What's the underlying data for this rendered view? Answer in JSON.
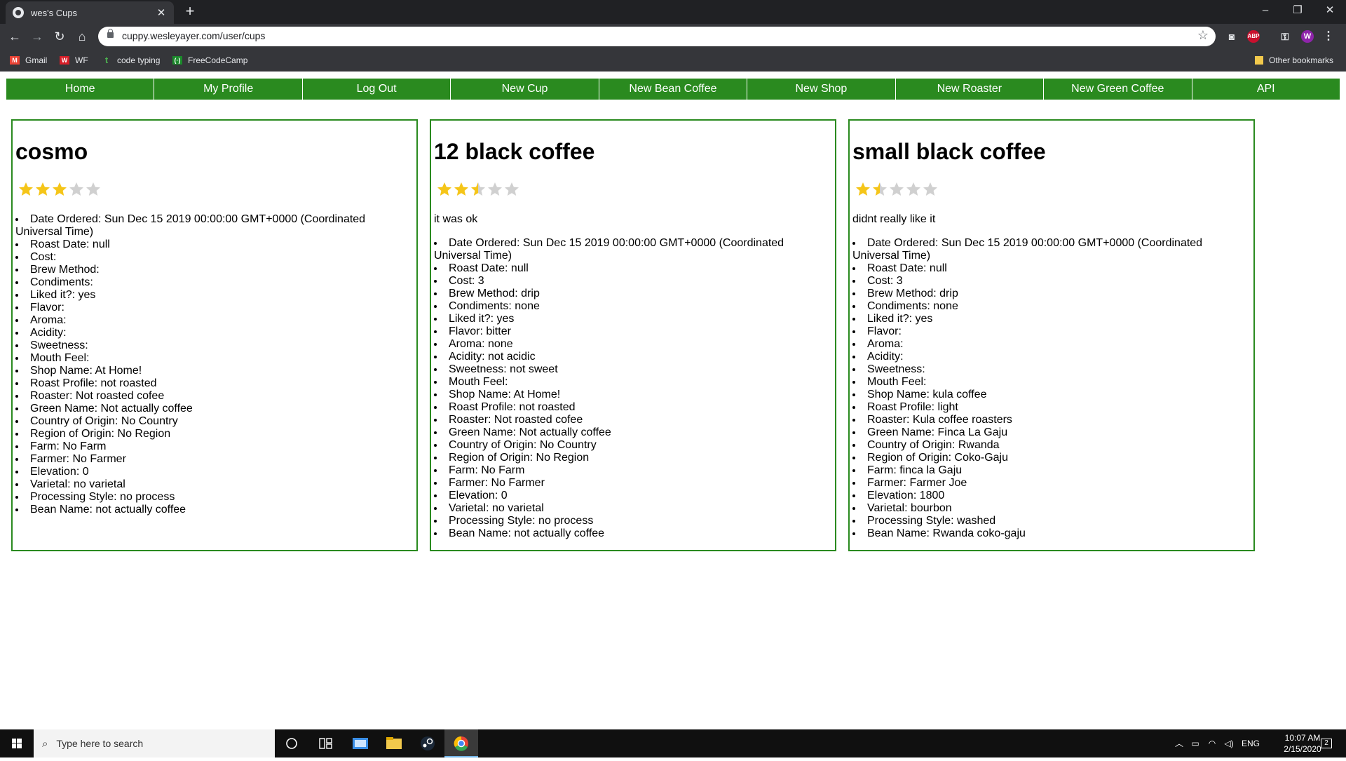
{
  "browser": {
    "tab_title": "wes's Cups",
    "url": "cuppy.wesleyayer.com/user/cups",
    "profile_initial": "W",
    "abp_label": "ABP",
    "bookmarks": [
      {
        "label": "Gmail",
        "icon": "gmail-icon",
        "color": "#ea4335"
      },
      {
        "label": "WF",
        "icon": "wf-icon",
        "color": "#d71e28"
      },
      {
        "label": "code typing",
        "icon": "t-icon",
        "color": "#4caf50"
      },
      {
        "label": "FreeCodeCamp",
        "icon": "freecodecamp-icon",
        "color": "#1b8a2b"
      }
    ],
    "other_bookmarks": "Other bookmarks"
  },
  "nav": {
    "items": [
      "Home",
      "My Profile",
      "Log Out",
      "New Cup",
      "New Bean Coffee",
      "New Shop",
      "New Roaster",
      "New Green Coffee",
      "API"
    ]
  },
  "colors": {
    "accent": "#2a8a1f",
    "star_filled": "#f5c518",
    "star_empty": "#d0d0d0"
  },
  "cups": [
    {
      "name": "cosmo",
      "rating": 3,
      "comment": "",
      "details": [
        "Date Ordered: Sun Dec 15 2019 00:00:00 GMT+0000 (Coordinated Universal Time)",
        "Roast Date: null",
        "Cost:",
        "Brew Method:",
        "Condiments:",
        "Liked it?: yes",
        "Flavor:",
        "Aroma:",
        "Acidity:",
        "Sweetness:",
        "Mouth Feel:",
        "Shop Name: At Home!",
        "Roast Profile: not roasted",
        "Roaster: Not roasted cofee",
        "Green Name: Not actually coffee",
        "Country of Origin: No Country",
        "Region of Origin: No Region",
        "Farm: No Farm",
        "Farmer: No Farmer",
        "Elevation: 0",
        "Varietal: no varietal",
        "Processing Style: no process",
        "Bean Name: not actually coffee"
      ]
    },
    {
      "name": "12 black coffee",
      "rating": 2.5,
      "comment": "it was ok",
      "details": [
        "Date Ordered: Sun Dec 15 2019 00:00:00 GMT+0000 (Coordinated Universal Time)",
        "Roast Date: null",
        "Cost: 3",
        "Brew Method: drip",
        "Condiments: none",
        "Liked it?: yes",
        "Flavor: bitter",
        "Aroma: none",
        "Acidity: not acidic",
        "Sweetness: not sweet",
        "Mouth Feel:",
        "Shop Name: At Home!",
        "Roast Profile: not roasted",
        "Roaster: Not roasted cofee",
        "Green Name: Not actually coffee",
        "Country of Origin: No Country",
        "Region of Origin: No Region",
        "Farm: No Farm",
        "Farmer: No Farmer",
        "Elevation: 0",
        "Varietal: no varietal",
        "Processing Style: no process",
        "Bean Name: not actually coffee"
      ]
    },
    {
      "name": "small black coffee",
      "rating": 1.5,
      "comment": "didnt really like it",
      "details": [
        "Date Ordered: Sun Dec 15 2019 00:00:00 GMT+0000 (Coordinated Universal Time)",
        "Roast Date: null",
        "Cost: 3",
        "Brew Method: drip",
        "Condiments: none",
        "Liked it?: yes",
        "Flavor:",
        "Aroma:",
        "Acidity:",
        "Sweetness:",
        "Mouth Feel:",
        "Shop Name: kula coffee",
        "Roast Profile: light",
        "Roaster: Kula coffee roasters",
        "Green Name: Finca La Gaju",
        "Country of Origin: Rwanda",
        "Region of Origin: Coko-Gaju",
        "Farm: finca la Gaju",
        "Farmer: Farmer Joe",
        "Elevation: 1800",
        "Varietal: bourbon",
        "Processing Style: washed",
        "Bean Name: Rwanda coko-gaju"
      ]
    }
  ],
  "taskbar": {
    "search_placeholder": "Type here to search",
    "language": "ENG",
    "time": "10:07 AM",
    "date": "2/15/2020",
    "notifications": "2"
  }
}
